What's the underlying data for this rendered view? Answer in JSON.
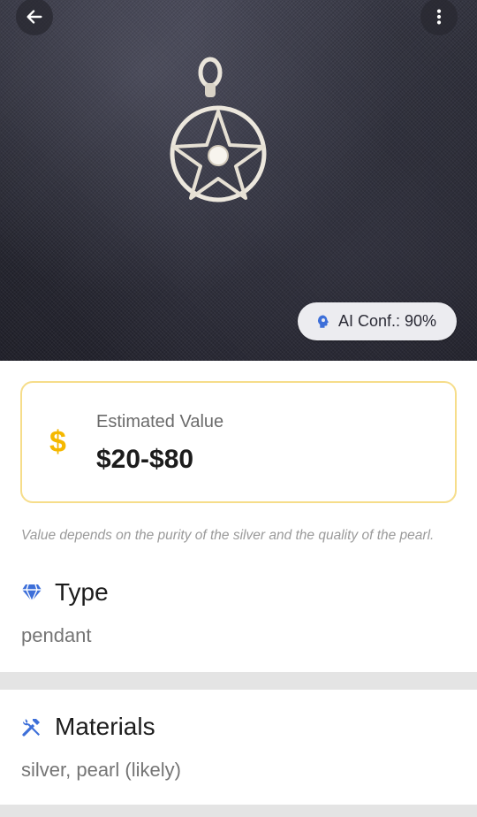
{
  "toolbar": {
    "back_icon": "arrow-left-icon",
    "more_icon": "more-vertical-icon"
  },
  "photo": {
    "ai_confidence_label": "AI Conf.: 90%",
    "ai_confidence_icon": "ai-brain-icon"
  },
  "estimate": {
    "icon": "dollar-icon",
    "label": "Estimated Value",
    "amount": "$20-$80",
    "accent_color": "#f5b800",
    "border_color": "#f6dd8a",
    "note": "Value depends on the purity of the silver and the quality of the pearl."
  },
  "type": {
    "icon": "diamond-icon",
    "title": "Type",
    "value": "pendant"
  },
  "materials": {
    "icon": "tools-icon",
    "title": "Materials",
    "value": "silver, pearl (likely)"
  },
  "colors": {
    "icon_blue": "#3d6fd9",
    "text_dark": "#1c1c1c",
    "text_muted": "#757575"
  }
}
